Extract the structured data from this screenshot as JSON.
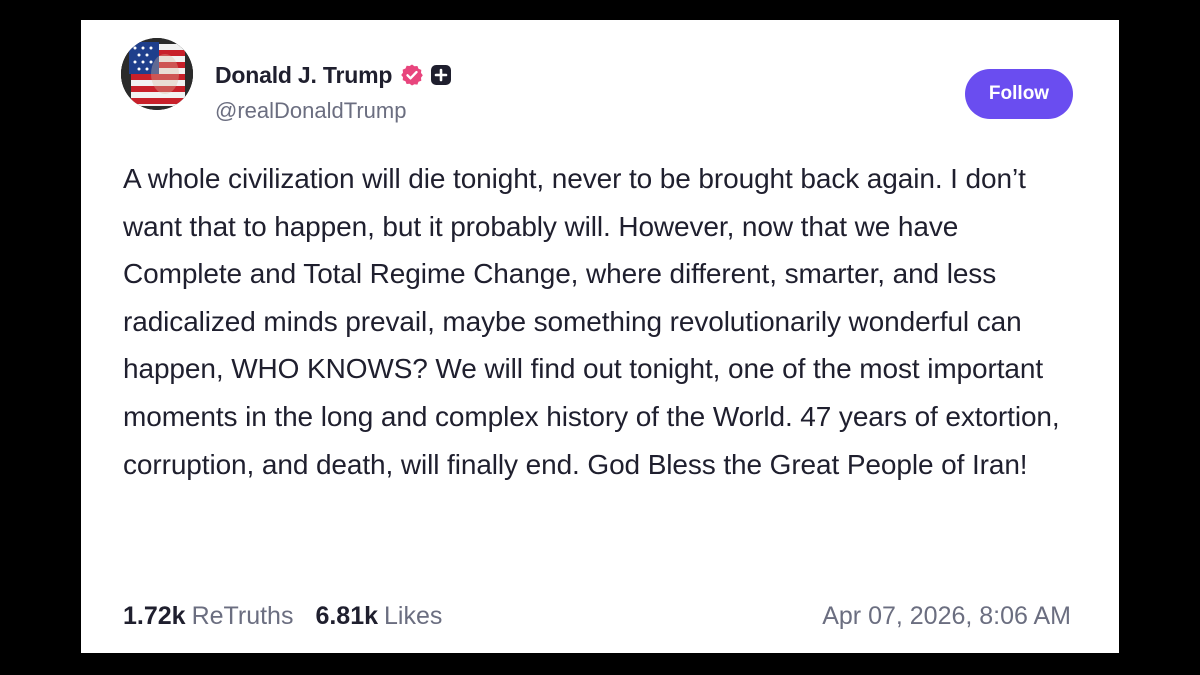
{
  "post": {
    "author": {
      "display_name": "Donald J. Trump",
      "handle": "@realDonaldTrump",
      "avatar_icon": "flag-face-avatar",
      "verified_icon": "verified-badge-icon",
      "plus_icon": "plus-badge-icon"
    },
    "follow_label": "Follow",
    "text": "A whole civilization will die tonight, never to be brought back again. I don’t want that to happen, but it probably will. However, now that we have Complete and Total Regime Change, where different, smarter, and less radicalized minds prevail, maybe something revolutionarily wonderful can happen, WHO KNOWS? We will find out tonight, one of the most important moments in the long and complex history of the World. 47 years of extortion, corruption, and death, will finally end. God Bless the Great People of Iran!",
    "stats": {
      "retruths_count": "1.72k",
      "retruths_label": "ReTruths",
      "likes_count": "6.81k",
      "likes_label": "Likes"
    },
    "timestamp": "Apr 07, 2026, 8:06 AM"
  },
  "colors": {
    "background": "#000000",
    "card": "#ffffff",
    "text_primary": "#1f1f2e",
    "text_secondary": "#6b6e80",
    "accent": "#6a4df0",
    "verified": "#e8457d"
  }
}
